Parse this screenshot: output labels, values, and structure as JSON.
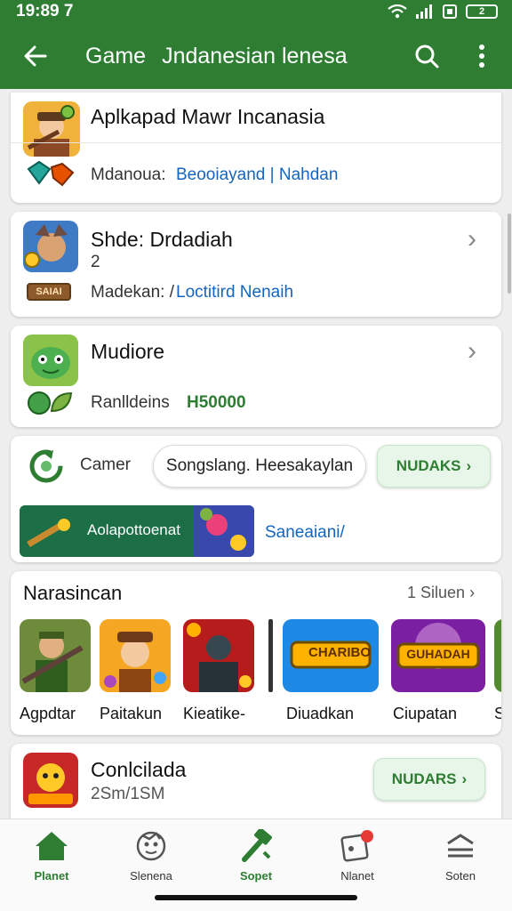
{
  "status_bar": {
    "time": "19:89 7",
    "battery": "2"
  },
  "app_bar": {
    "title_1": "Game",
    "title_2": "Jndanesian",
    "title_3": "lenesa"
  },
  "colors": {
    "primary": "#2e7d32",
    "link": "#1565c0",
    "accent_green": "#2e7d32"
  },
  "header_card": {
    "title": "Aplkapad Mawr Incanasia",
    "meta_label": "Mdanoua:",
    "meta_link": "Beooiayand | Nahdan"
  },
  "item_1": {
    "title": "Shde: Drdadiah",
    "count": "2",
    "badge": "SAIAI",
    "meta_label": "Madekan: /",
    "meta_link": "Loctitird Nenaih"
  },
  "item_2": {
    "title": "Mudiore",
    "meta_label": "Ranlldeins",
    "meta_value": "H50000"
  },
  "promo_card": {
    "label": "Camer",
    "chip_text": "Songslang. Heesakaylan",
    "action": "NUDAKS",
    "banner_text": "Aolapottoenat",
    "banner_link": "Saneaiani/"
  },
  "games_section": {
    "title": "Narasincan",
    "more": "1 Siluen",
    "games": [
      {
        "name": "Agpdtar"
      },
      {
        "name": "Paitakun"
      },
      {
        "name": "Kieatike-"
      },
      {
        "name": "Diuadkan",
        "art_text": "CHARIBO"
      },
      {
        "name": "Ciupatan",
        "art_text": "GUHADAH"
      },
      {
        "name": "S"
      }
    ]
  },
  "bottom_item": {
    "title": "Conlcilada",
    "subtitle": "2Sm/1SM",
    "action": "NUDARS"
  },
  "bottom_nav": [
    {
      "label": "Planet",
      "icon": "home-icon"
    },
    {
      "label": "Slenena",
      "icon": "controller-icon"
    },
    {
      "label": "Sopet",
      "icon": "hammer-icon"
    },
    {
      "label": "Nlanet",
      "icon": "notification-icon"
    },
    {
      "label": "Soten",
      "icon": "menu-icon"
    }
  ]
}
